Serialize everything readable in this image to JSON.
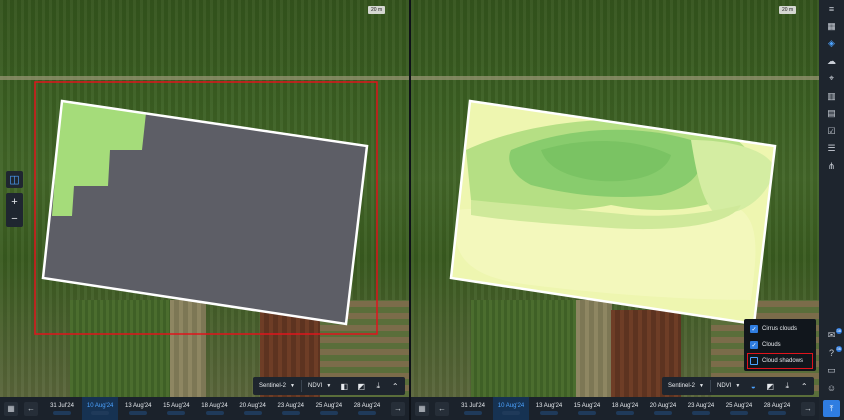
{
  "left_pane": {
    "scale": "20 m",
    "satellite": "Sentinel-2",
    "index": "NDVI"
  },
  "right_pane": {
    "scale": "20 m",
    "satellite": "Sentinel-2",
    "index": "NDVI"
  },
  "timeline": {
    "left_dates": [
      "31 Jul'24",
      "10 Aug'24",
      "13 Aug'24",
      "15 Aug'24",
      "18 Aug'24",
      "20 Aug'24",
      "23 Aug'24",
      "25 Aug'24",
      "28 Aug'24"
    ],
    "right_dates": [
      "31 Jul'24",
      "10 Aug'24",
      "13 Aug'24",
      "15 Aug'24",
      "18 Aug'24",
      "20 Aug'24",
      "23 Aug'24",
      "25 Aug'24",
      "28 Aug'24"
    ],
    "active_index": 1
  },
  "layers_popup": {
    "items": [
      {
        "label": "Cirrus clouds",
        "checked": true
      },
      {
        "label": "Clouds",
        "checked": true
      },
      {
        "label": "Cloud shadows",
        "checked": false
      }
    ]
  },
  "sidebar": {
    "icons": [
      "menu-icon",
      "calendar-icon",
      "layers-icon",
      "cloud-icon",
      "location-icon",
      "bar-chart-icon",
      "database-icon",
      "checklist-icon",
      "stack-icon",
      "network-icon"
    ],
    "badges": {
      "notifications": "38",
      "help": "36"
    }
  },
  "colors": {
    "accent": "#2f7de1",
    "cloud_mask": "#5d5e66",
    "field_border": "#ffffff",
    "highlight": "#e0141c",
    "ndvi_light": "#f2f7b8",
    "ndvi_mid": "#b9e080",
    "ndvi_dark": "#7ecb6a"
  }
}
